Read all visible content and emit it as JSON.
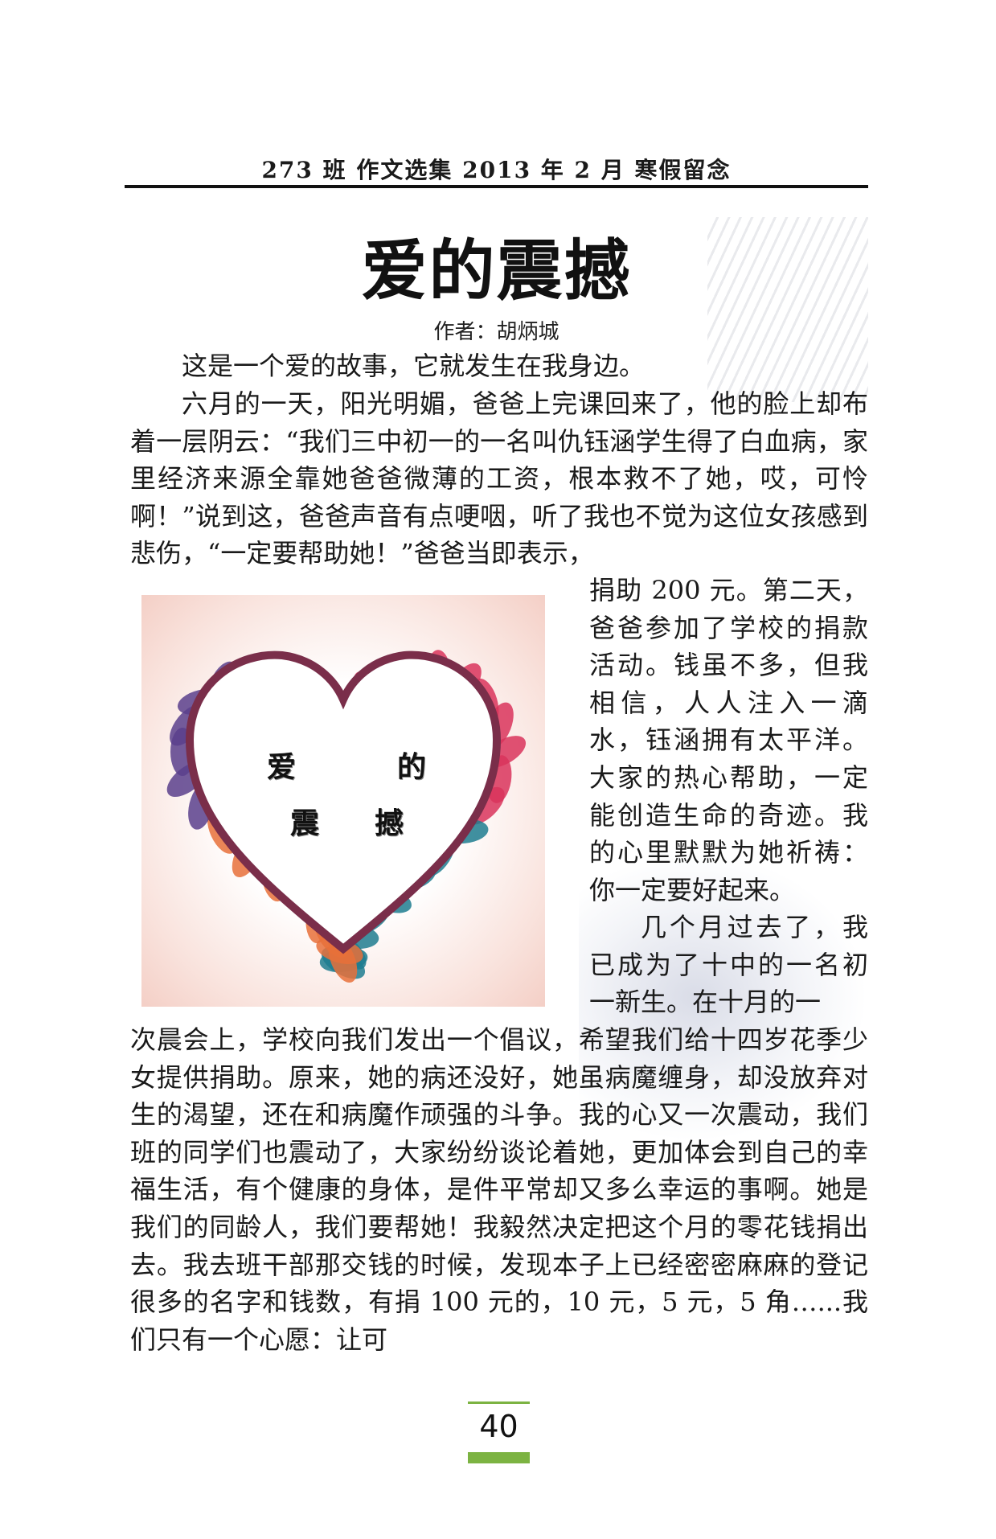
{
  "header": {
    "text": "273 班 作文选集 2013 年 2 月 寒假留念"
  },
  "article": {
    "title": "爱的震撼",
    "author": "作者：胡炳城",
    "paragraphs": [
      "这是一个爱的故事，它就发生在我身边。",
      "六月的一天，阳光明媚，爸爸上完课回来了，他的脸上却布着一层阴云：“我们三中初一的一名叫仇钰涵学生得了白血病，家里经济来源全靠她爸爸微薄的工资，根本救不了她，哎，可怜啊！”说到这，爸爸声音有点哽咽，听了我也不觉为这位女孩感到悲伤，“一定要帮助她！”爸爸当即表示，",
      "捐助 200 元。第二天，爸爸参加了学校的捐款活动。钱虽不多，但我相信，人人注入一滴水，钰涵拥有太平洋。大家的热心帮助，一定能创造生命的奇迹。我的心里默默为她祈祷：你一定要好起来。",
      "几个月过去了，我已成为了十中的一名初一新生。在十月的一",
      "次晨会上，学校向我们发出一个倡议，希望我们给十四岁花季少女提供捐助。原来，她的病还没好，她虽病魔缠身，却没放弃对生的渴望，还在和病魔作顽强的斗争。我的心又一次震动，我们班的同学们也震动了，大家纷纷谈论着她，更加体会到自己的幸福生活，有个健康的身体，是件平常却又多么幸运的事啊。她是我们的同龄人，我们要帮她！我毅然决定把这个月的零花钱捐出去。我去班干部那交钱的时候，发现本子上已经密密麻麻的登记很多的名字和钱数，有捐 100 元的，10 元，5 元，5 角…...我们只有一个心愿：让可"
    ]
  },
  "illustration": {
    "chars": [
      "爱",
      "的",
      "震",
      "撼"
    ],
    "leaf_colors": [
      "#5b3f8c",
      "#d9345c",
      "#e8703a",
      "#1f7d8f"
    ]
  },
  "footer": {
    "page_number": "40",
    "accent_color": "#7cb342"
  }
}
